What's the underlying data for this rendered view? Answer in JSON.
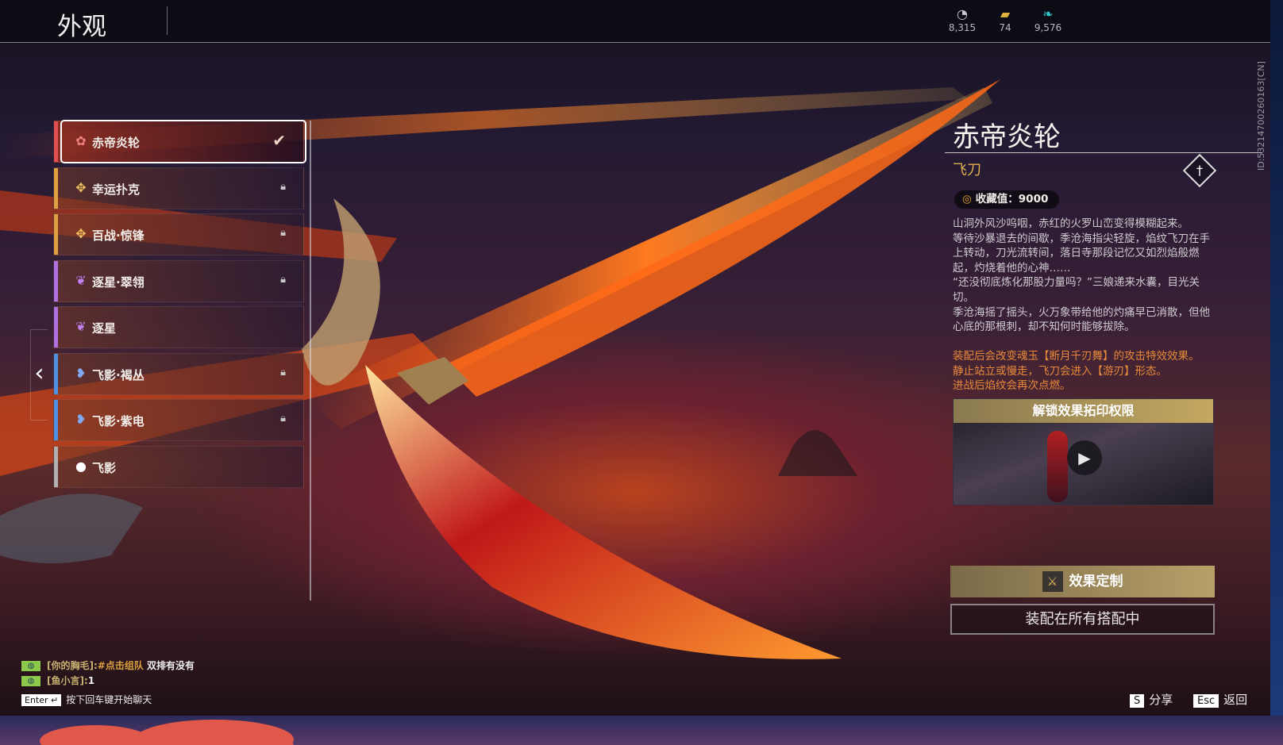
{
  "header": {
    "title": "外观"
  },
  "currencies": [
    {
      "icon": "coin-icon",
      "value": "8,315",
      "color": "#c8c8d0"
    },
    {
      "icon": "gold-bar-icon",
      "value": "74",
      "color": "#e0b040"
    },
    {
      "icon": "feather-icon",
      "value": "9,576",
      "color": "#30c8d0"
    }
  ],
  "skins": [
    {
      "name": "赤帝炎轮",
      "icon": "flower-icon",
      "glyph": "✿",
      "color": "#e05050",
      "glyphColor": "#f08080",
      "state": "equipped"
    },
    {
      "name": "幸运扑克",
      "icon": "clover-icon",
      "glyph": "✥",
      "color": "#e0a040",
      "glyphColor": "#f0c060",
      "state": "locked"
    },
    {
      "name": "百战·惊锋",
      "icon": "clover-icon",
      "glyph": "✥",
      "color": "#e0a040",
      "glyphColor": "#f0c060",
      "state": "locked"
    },
    {
      "name": "逐星·翠翎",
      "icon": "trefoil-icon",
      "glyph": "❦",
      "color": "#b070e0",
      "glyphColor": "#c080f0",
      "state": "locked"
    },
    {
      "name": "逐星",
      "icon": "trefoil-icon",
      "glyph": "❦",
      "color": "#b070e0",
      "glyphColor": "#c080f0",
      "state": "unlocked"
    },
    {
      "name": "飞影·褐丛",
      "icon": "butterfly-icon",
      "glyph": "❥",
      "color": "#5090e0",
      "glyphColor": "#80a8f0",
      "state": "locked"
    },
    {
      "name": "飞影·紫电",
      "icon": "butterfly-icon",
      "glyph": "❥",
      "color": "#5090e0",
      "glyphColor": "#80a8f0",
      "state": "locked"
    },
    {
      "name": "飞影",
      "icon": "drop-icon",
      "glyph": "●",
      "color": "#b0b0b0",
      "glyphColor": "#ffffff",
      "state": "unlocked"
    }
  ],
  "detail": {
    "name": "赤帝炎轮",
    "type": "飞刀",
    "collection": "收藏值：9000",
    "description": "山洞外风沙呜咽，赤红的火罗山峦变得模糊起来。\n等待沙暴退去的间歇，季沧海指尖轻旋，焰纹飞刀在手上转动，刀光流转间，落日寺那段记忆又如烈焰般燃起，灼烧着他的心神……\n“还没彻底炼化那股力量吗？”三娘递来水囊，目光关切。\n季沧海摇了摇头，火万象带给他的灼痛早已消散，但他心底的那根刺，却不知何时能够拔除。",
    "effect": "装配后会改变魂玉【断月千刃舞】的攻击特效效果。\n静止站立或慢走，飞刀会进入【游刃】形态。\n进战后焰纹会再次点燃。",
    "video_title": "解锁效果拓印权限",
    "customize_label": "效果定制",
    "equip_all_label": "装配在所有搭配中"
  },
  "player_id": "ID:5321470026​0163[CN]",
  "chat": [
    {
      "sender": "[你的胸毛]:",
      "link": "#点击组队",
      "text": " 双排有没有"
    },
    {
      "sender": "[鱼小言]:",
      "link": "",
      "text": "1"
    }
  ],
  "chat_hint": {
    "key": "Enter ↵",
    "text": "按下回车键开始聊天"
  },
  "shortcuts": [
    {
      "key": "S",
      "label": "分享"
    },
    {
      "key": "Esc",
      "label": "返回"
    }
  ]
}
